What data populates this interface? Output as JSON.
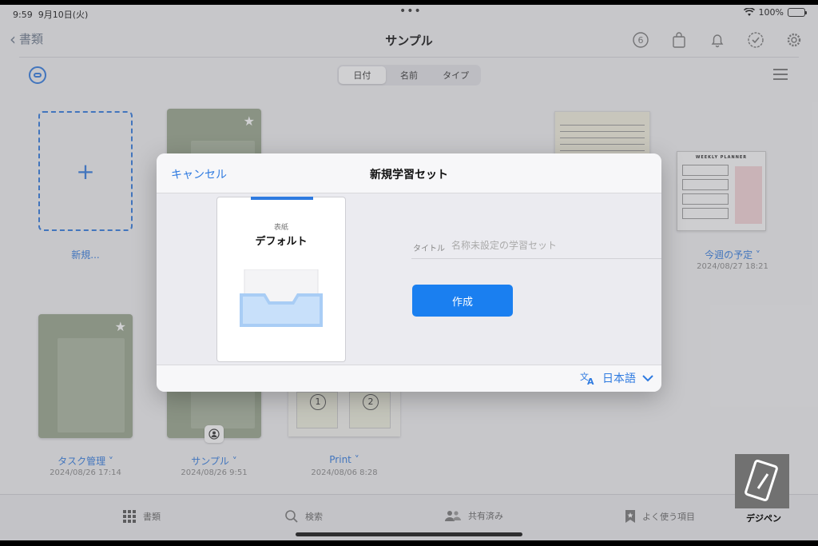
{
  "status": {
    "time": "9:59",
    "date": "9月10日(火)",
    "battery": "100%"
  },
  "nav": {
    "back_label": "書類",
    "title": "サンプル",
    "notification_count": "6"
  },
  "sort": {
    "tabs": [
      "日付",
      "名前",
      "タイプ"
    ],
    "active": "日付"
  },
  "items": {
    "new_label": "新規...",
    "task": {
      "label": "タスク管理",
      "date": "2024/08/26 17:14"
    },
    "sample": {
      "label": "サンプル",
      "date": "2024/08/26 9:51"
    },
    "print": {
      "label": "Print",
      "date": "2024/08/06 8:28",
      "page1": "1",
      "page2": "2"
    },
    "weekly": {
      "label": "今週の予定",
      "date": "2024/08/27 18:21",
      "planner_title": "WEEKLY PLANNER"
    }
  },
  "modal": {
    "cancel": "キャンセル",
    "title": "新規学習セット",
    "cover_small": "表紙",
    "cover_name": "デフォルト",
    "title_label": "タイトル",
    "title_placeholder": "名称未設定の学習セット",
    "create": "作成",
    "language": "日本語"
  },
  "tabbar": [
    "書類",
    "検索",
    "共有済み",
    "よく使う項目"
  ],
  "watermark": "デジペン",
  "colors": {
    "accent": "#2e7ae0",
    "button": "#1a7ff0",
    "cover": "#98a58c"
  }
}
